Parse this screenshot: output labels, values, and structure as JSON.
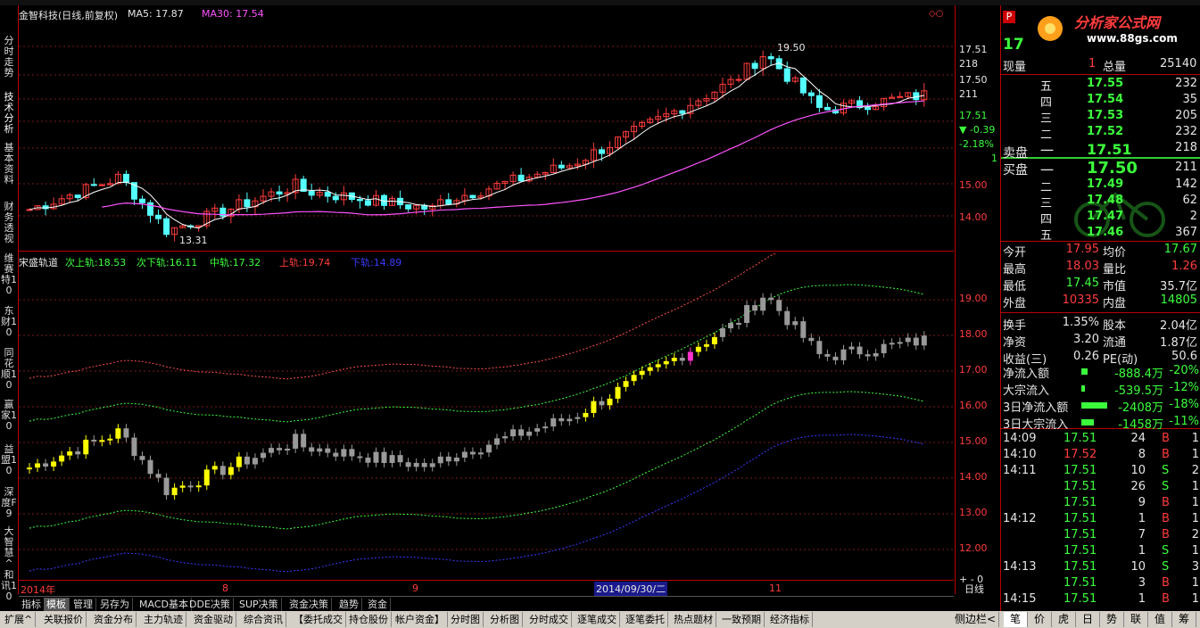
{
  "left_nav": [
    "分时走势",
    "技术分析",
    "基本资料",
    "财务透视",
    "维赛特10",
    "东财10",
    "同花顺10",
    "赢家10",
    "益盟10",
    "深度F9",
    "大智慧^",
    "和讯10"
  ],
  "main_chart": {
    "title": "金智科技(日线,前复权)",
    "ma5_label": "MA5: 17.87",
    "ma30_label": "MA30: 17.54",
    "high_marker": "19.50",
    "low_marker": "13.31",
    "close_marker": "—",
    "right_labels": [
      "17.51",
      "218",
      "17.50",
      "211",
      "17.51",
      "▼ -0.39",
      "-2.18%",
      "1"
    ],
    "y_ticks": [
      "15.00",
      "14.00"
    ]
  },
  "sub_chart": {
    "name": "宋盛轨道",
    "legend": [
      {
        "label": "次上轨:",
        "value": "18.53",
        "color": "#3cff3c"
      },
      {
        "label": "次下轨:",
        "value": "16.11",
        "color": "#3cff3c"
      },
      {
        "label": "中轨:",
        "value": "17.32",
        "color": "#3cff3c"
      },
      {
        "label": "上轨:",
        "value": "19.74",
        "color": "#ff3c3c"
      },
      {
        "label": "下轨:",
        "value": "14.89",
        "color": "#3c3cff"
      }
    ],
    "y_ticks": [
      "19.00",
      "18.00",
      "17.00",
      "16.00",
      "15.00",
      "14.00",
      "13.00",
      "12.00"
    ]
  },
  "x_axis": {
    "labels": [
      "2014年",
      "8",
      "9",
      "2014/09/30/二",
      "11"
    ],
    "period": "日线"
  },
  "bottom_tabs": [
    "指标",
    "模板",
    "管理",
    "另存为",
    "MACD基本",
    "DDE决策",
    "SUP决策",
    "资金决策",
    "趋势",
    "资金"
  ],
  "bottom_bar": [
    "扩展^",
    "关联报价",
    "资金分布",
    "主力轨迹",
    "资金驱动",
    "综合资讯",
    "【委托成交",
    "持仓股份",
    "帐户资金】",
    "分时图",
    "分析图",
    "分时成交",
    "逐笔成交",
    "逐笔委托",
    "热点题材",
    "一致预期",
    "经济指标"
  ],
  "right_panel": {
    "code_short": "17",
    "logo_text": "分析家公式网",
    "logo_url": "www.88gs.com",
    "xianliang_label": "现量",
    "xianliang": "1",
    "zongliang_label": "总量",
    "zongliang": "25140",
    "asks": [
      {
        "label": "五",
        "price": "17.55",
        "vol": "232"
      },
      {
        "label": "四",
        "price": "17.54",
        "vol": "35"
      },
      {
        "label": "三",
        "price": "17.53",
        "vol": "205"
      },
      {
        "label": "二",
        "price": "17.52",
        "vol": "232"
      },
      {
        "label": "一",
        "price": "17.51",
        "vol": "218"
      }
    ],
    "sell_label": "卖盘",
    "buy_label": "买盘",
    "bids": [
      {
        "label": "一",
        "price": "17.50",
        "vol": "211"
      },
      {
        "label": "二",
        "price": "17.49",
        "vol": "142"
      },
      {
        "label": "三",
        "price": "17.48",
        "vol": "62"
      },
      {
        "label": "四",
        "price": "17.47",
        "vol": "2"
      },
      {
        "label": "五",
        "price": "17.46",
        "vol": "367"
      }
    ],
    "stats": [
      {
        "l1": "今开",
        "v1": "17.95",
        "l2": "均价",
        "v2": "17.67"
      },
      {
        "l1": "最高",
        "v1": "18.03",
        "l2": "量比",
        "v2": "1.26"
      },
      {
        "l1": "最低",
        "v1": "17.45",
        "l2": "市值",
        "v2": "35.7亿"
      },
      {
        "l1": "外盘",
        "v1": "10335",
        "l2": "内盘",
        "v2": "14805"
      },
      {
        "l1": "换手",
        "v1": "1.35%",
        "l2": "股本",
        "v2": "2.04亿"
      },
      {
        "l1": "净资",
        "v1": "3.20",
        "l2": "流通",
        "v2": "1.87亿"
      },
      {
        "l1": "收益(三)",
        "v1": "0.26",
        "l2": "PE(动)",
        "v2": "50.6"
      }
    ],
    "flows": [
      {
        "label": "净流入额",
        "value": "-888.4万",
        "pct": "-20%",
        "bar": 0.2
      },
      {
        "label": "大宗流入",
        "value": "-539.5万",
        "pct": "-12%",
        "bar": 0.1
      },
      {
        "label": "3日净流入额",
        "value": "-2408万",
        "pct": "-18%",
        "bar": 0.8
      },
      {
        "label": "3日大宗流入",
        "value": "-1458万",
        "pct": "-11%",
        "bar": 0.4
      }
    ],
    "ticks": [
      {
        "time": "14:09",
        "price": "17.51",
        "vol": "24",
        "side": "B",
        "n": "1"
      },
      {
        "time": "14:10",
        "price": "17.52",
        "vol": "8",
        "side": "B",
        "n": "1"
      },
      {
        "time": "14:11",
        "price": "17.51",
        "vol": "10",
        "side": "S",
        "n": "2"
      },
      {
        "time": "",
        "price": "17.51",
        "vol": "26",
        "side": "S",
        "n": "1"
      },
      {
        "time": "",
        "price": "17.51",
        "vol": "9",
        "side": "B",
        "n": "1"
      },
      {
        "time": "14:12",
        "price": "17.51",
        "vol": "1",
        "side": "B",
        "n": "1"
      },
      {
        "time": "",
        "price": "17.51",
        "vol": "7",
        "side": "B",
        "n": "2"
      },
      {
        "time": "",
        "price": "17.51",
        "vol": "1",
        "side": "S",
        "n": "1"
      },
      {
        "time": "14:13",
        "price": "17.51",
        "vol": "10",
        "side": "S",
        "n": "3"
      },
      {
        "time": "",
        "price": "17.51",
        "vol": "3",
        "side": "B",
        "n": "1"
      },
      {
        "time": "14:15",
        "price": "17.51",
        "vol": "1",
        "side": "B",
        "n": "1"
      }
    ],
    "bottom_tabs": [
      "笔",
      "价",
      "虎",
      "日",
      "势",
      "联",
      "值",
      "筹"
    ],
    "bottom_left": "侧边栏<"
  }
}
